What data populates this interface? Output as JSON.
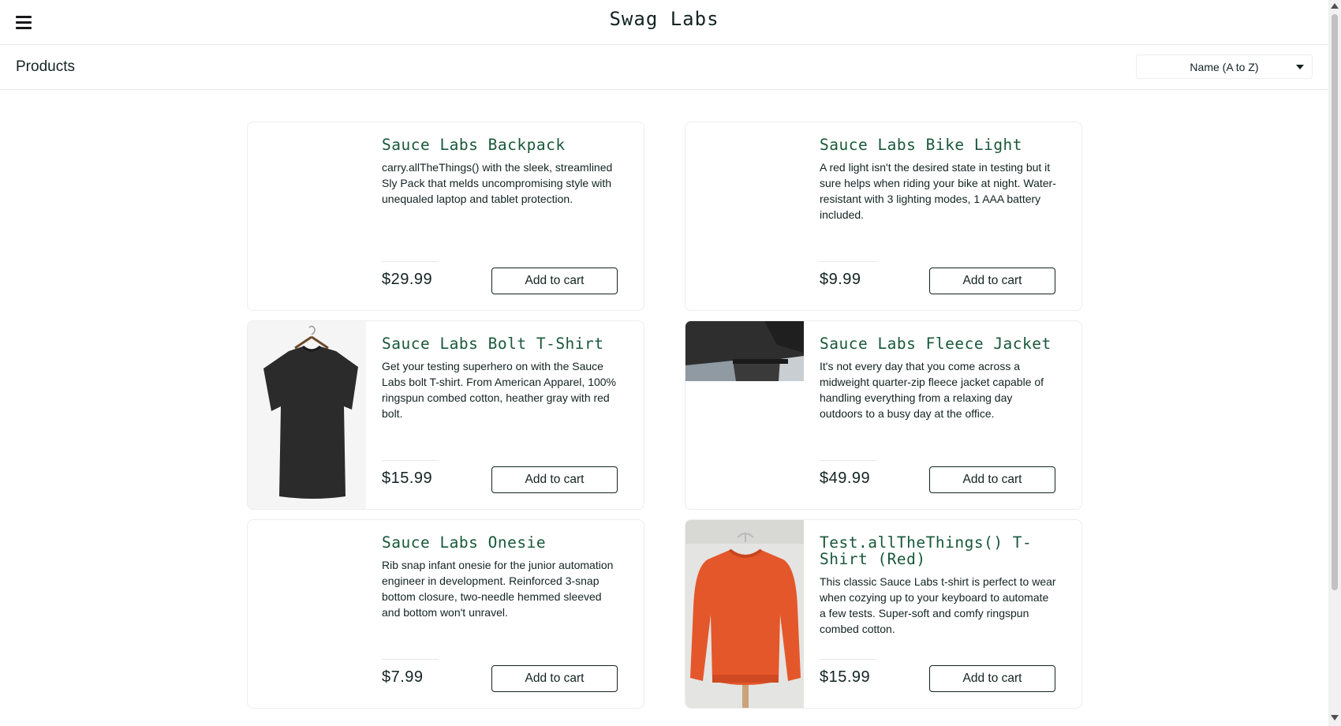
{
  "header": {
    "logo": "Swag Labs",
    "menu_icon": "hamburger-menu-icon"
  },
  "subheader": {
    "title": "Products",
    "sort_selected": "Name (A to Z)"
  },
  "products": [
    {
      "name": "Sauce Labs Backpack",
      "description": "carry.allTheThings() with the sleek, streamlined Sly Pack that melds uncompromising style with unequaled laptop and tablet protection.",
      "price": "$29.99",
      "button": "Add to cart"
    },
    {
      "name": "Sauce Labs Bike Light",
      "description": "A red light isn't the desired state in testing but it sure helps when riding your bike at night. Water-resistant with 3 lighting modes, 1 AAA battery included.",
      "price": "$9.99",
      "button": "Add to cart"
    },
    {
      "name": "Sauce Labs Bolt T-Shirt",
      "description": "Get your testing superhero on with the Sauce Labs bolt T-shirt. From American Apparel, 100% ringspun combed cotton, heather gray with red bolt.",
      "price": "$15.99",
      "button": "Add to cart"
    },
    {
      "name": "Sauce Labs Fleece Jacket",
      "description": "It's not every day that you come across a midweight quarter-zip fleece jacket capable of handling everything from a relaxing day outdoors to a busy day at the office.",
      "price": "$49.99",
      "button": "Add to cart"
    },
    {
      "name": "Sauce Labs Onesie",
      "description": "Rib snap infant onesie for the junior automation engineer in development. Reinforced 3-snap bottom closure, two-needle hemmed sleeved and bottom won't unravel.",
      "price": "$7.99",
      "button": "Add to cart"
    },
    {
      "name": "Test.allTheThings() T-Shirt (Red)",
      "description": "This classic Sauce Labs t-shirt is perfect to wear when cozying up to your keyboard to automate a few tests. Super-soft and comfy ringspun combed cotton.",
      "price": "$15.99",
      "button": "Add to cart"
    }
  ],
  "colors": {
    "title_green": "#18583a",
    "text": "#132322",
    "border": "#ededed"
  }
}
